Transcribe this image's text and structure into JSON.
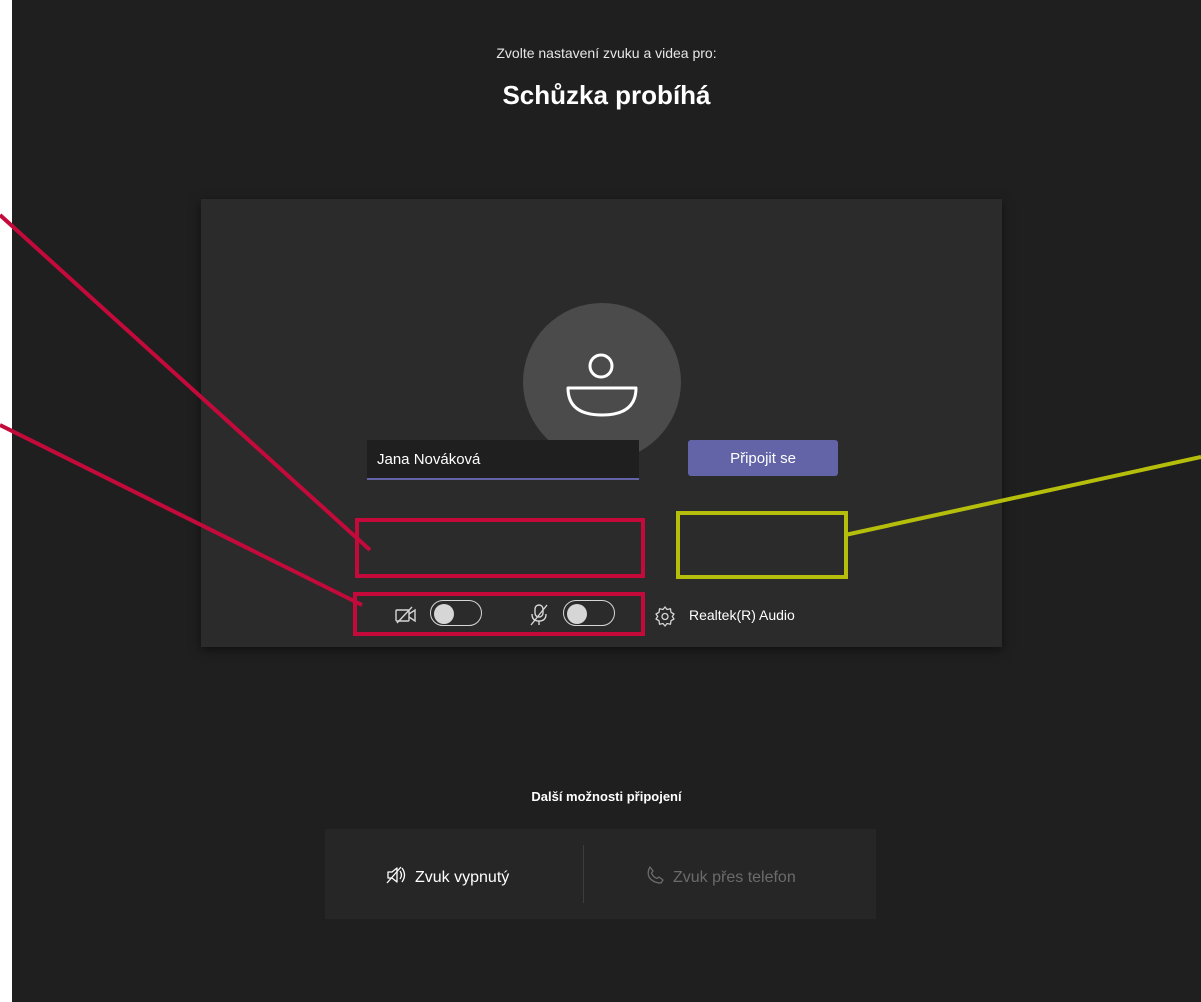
{
  "header": {
    "subtitle": "Zvolte nastavení zvuku a videa pro:",
    "title": "Schůzka probíhá"
  },
  "prejoin": {
    "avatar_icon": "person-icon",
    "name_input": {
      "value": "Jana Nováková",
      "placeholder": ""
    },
    "join_button": "Připojit se",
    "camera": {
      "icon": "camera-off-icon",
      "enabled": false
    },
    "microphone": {
      "icon": "mic-off-icon",
      "enabled": false
    },
    "device_settings": {
      "icon": "gear-icon",
      "label": "Realtek(R) Audio"
    }
  },
  "more_options": {
    "title": "Další možnosti připojení",
    "audio_off": {
      "icon": "speaker-off-icon",
      "label": "Zvuk vypnutý"
    },
    "phone_audio": {
      "icon": "phone-icon",
      "label": "Zvuk přes telefon"
    }
  },
  "colors": {
    "background": "#1f1f1f",
    "card": "#2b2b2b",
    "accent": "#6264a7",
    "annotation_red": "#c40a3b",
    "annotation_lime": "#b5bf0b"
  }
}
